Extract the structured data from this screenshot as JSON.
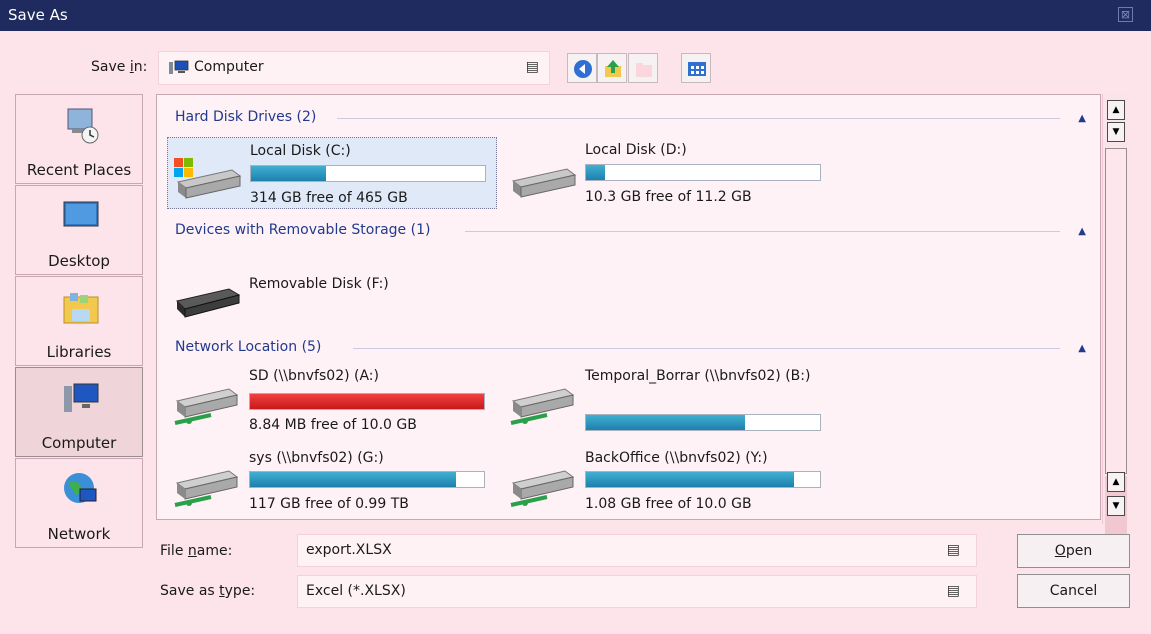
{
  "window": {
    "title": "Save As",
    "close_glyph": "⊠"
  },
  "savein": {
    "label_pre": "Save ",
    "label_u": "i",
    "label_post": "n:",
    "value": "Computer",
    "dropdown_glyph": "▤"
  },
  "toolbar": {
    "back_icon": "back-arrow-icon",
    "up_icon": "up-folder-icon",
    "newfolder_icon": "new-folder-icon",
    "views_icon": "views-menu-icon"
  },
  "places": [
    {
      "label": "Recent Places",
      "icon": "recent-places-icon"
    },
    {
      "label": "Desktop",
      "icon": "desktop-icon"
    },
    {
      "label": "Libraries",
      "icon": "libraries-icon"
    },
    {
      "label": "Computer",
      "icon": "computer-icon",
      "selected": true
    },
    {
      "label": "Network",
      "icon": "network-icon"
    }
  ],
  "groups": [
    {
      "title": "Hard Disk Drives (2)"
    },
    {
      "title": "Devices with Removable Storage (1)"
    },
    {
      "title": "Network Location (5)"
    }
  ],
  "drives": [
    {
      "name": "Local Disk (C:)",
      "free": "314 GB free of 465 GB",
      "used_fraction": 0.32
    },
    {
      "name": "Local Disk (D:)",
      "free": "10.3 GB free of 11.2 GB",
      "used_fraction": 0.08
    },
    {
      "name": "Removable Disk (F:)"
    },
    {
      "name": "SD (\\\\bnvfs02) (A:)",
      "free": "8.84 MB free of 10.0 GB",
      "used_fraction": 0.999
    },
    {
      "name": "Temporal_Borrar (\\\\bnvfs02) (B:)",
      "used_fraction": 0.68
    },
    {
      "name": "sys (\\\\bnvfs02) (G:)",
      "free": "117 GB free of 0.99 TB",
      "used_fraction": 0.88
    },
    {
      "name": "BackOffice (\\\\bnvfs02) (Y:)",
      "free": "1.08 GB free of 10.0 GB",
      "used_fraction": 0.89
    }
  ],
  "filename": {
    "label_pre": "File ",
    "label_u": "n",
    "label_post": "ame:",
    "value": "export.XLSX"
  },
  "savetype": {
    "label_pre": "Save as ",
    "label_u": "t",
    "label_post": "ype:",
    "value": "Excel (*.XLSX)"
  },
  "buttons": {
    "open_u": "O",
    "open_rest": "pen",
    "cancel": "Cancel"
  },
  "colors": {
    "titlebar": "#1f2a5e",
    "background": "#fce4ea",
    "group_header": "#213a8e",
    "bar_fill": "#2a95c0",
    "bar_critical": "#d81f1f"
  }
}
